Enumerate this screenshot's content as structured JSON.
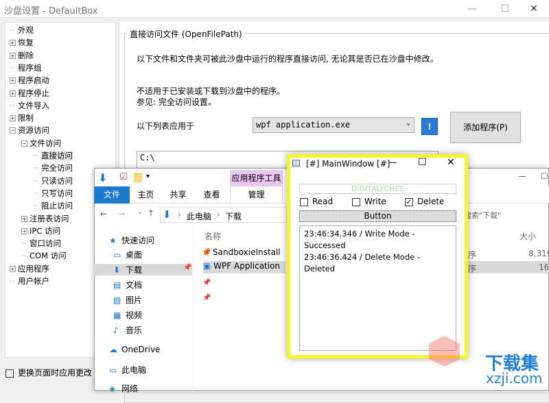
{
  "window": {
    "title": "沙盘设置 - DefaultBox",
    "min": "—",
    "max": "☐",
    "close": "✕"
  },
  "tree": [
    {
      "label": "外观",
      "level": 0,
      "exp": ""
    },
    {
      "label": "恢复",
      "level": 0,
      "exp": "+"
    },
    {
      "label": "删除",
      "level": 0,
      "exp": "+"
    },
    {
      "label": "程序组",
      "level": 0,
      "exp": ""
    },
    {
      "label": "程序启动",
      "level": 0,
      "exp": "+"
    },
    {
      "label": "程序停止",
      "level": 0,
      "exp": "+"
    },
    {
      "label": "文件导入",
      "level": 0,
      "exp": ""
    },
    {
      "label": "限制",
      "level": 0,
      "exp": "+"
    },
    {
      "label": "资源访问",
      "level": 0,
      "exp": "−"
    },
    {
      "label": "文件访问",
      "level": 1,
      "exp": "−"
    },
    {
      "label": "直接访问",
      "level": 2,
      "exp": "",
      "selected": true
    },
    {
      "label": "完全访问",
      "level": 2,
      "exp": ""
    },
    {
      "label": "只读访问",
      "level": 2,
      "exp": ""
    },
    {
      "label": "只写访问",
      "level": 2,
      "exp": ""
    },
    {
      "label": "阻止访问",
      "level": 2,
      "exp": ""
    },
    {
      "label": "注册表访问",
      "level": 1,
      "exp": "+"
    },
    {
      "label": "IPC 访问",
      "level": 1,
      "exp": "+"
    },
    {
      "label": "窗口访问",
      "level": 1,
      "exp": ""
    },
    {
      "label": "COM 访问",
      "level": 1,
      "exp": ""
    },
    {
      "label": "应用程序",
      "level": 0,
      "exp": "+"
    },
    {
      "label": "用户帐户",
      "level": 0,
      "exp": ""
    }
  ],
  "apply_on_change": "更换页面时应用更改",
  "group": {
    "title": "直接访问文件 (OpenFilePath)",
    "desc": "以下文件和文件夹可被此沙盘中运行的程序直接访问, 无论其是否已在沙盘中修改。",
    "note1": "不适用于已安装或下载到沙盘中的程序。",
    "note2": "参见: 完全访问设置。",
    "apply_label": "以下列表应用于",
    "program": "wpf application.exe",
    "bang": "!",
    "add": "添加程序(P)",
    "paths": [
      "C:\\"
    ]
  },
  "explorer": {
    "tools_tab": "应用程序工具",
    "tabs": [
      "文件",
      "主页",
      "共享",
      "查看",
      "管理"
    ],
    "breadcrumb": [
      "此电脑",
      "下载"
    ],
    "search": "搜索\"下载\"",
    "nav": [
      {
        "label": "快速访问",
        "icon": "★"
      },
      {
        "label": "桌面",
        "icon": "▭"
      },
      {
        "label": "下载",
        "icon": "⬇"
      },
      {
        "label": "文档",
        "icon": "▤"
      },
      {
        "label": "图片",
        "icon": "▨"
      },
      {
        "label": "视频",
        "icon": "▦"
      },
      {
        "label": "音乐",
        "icon": "♪"
      },
      {
        "label": "OneDrive",
        "icon": "☁"
      },
      {
        "label": "此电脑",
        "icon": "▭"
      },
      {
        "label": "网络",
        "icon": "◈"
      }
    ],
    "col_name": "名称",
    "col_size": "大小",
    "files": [
      {
        "name": "SandboxieInstall",
        "type": "序",
        "size": "8,319"
      },
      {
        "name": "WPF Application",
        "type": "序",
        "size": "16"
      }
    ]
  },
  "mainwindow": {
    "title": "[#] MainWindow [#]",
    "textbox": "DIGITALYCHEE",
    "read": "Read",
    "write": "Write",
    "delete": "Delete",
    "read_checked": false,
    "write_checked": false,
    "delete_checked": true,
    "button": "Button",
    "log": [
      "23:46:34.346 / Write Mode - Successed",
      "23:46:36.424 / Delete Mode - Deleted"
    ]
  },
  "watermark": {
    "text": "下载集",
    "url": "xzji.com"
  },
  "colors": {
    "accent": "#1979ca",
    "highlight": "#f5f52a",
    "tools": "#e8c8f0"
  }
}
